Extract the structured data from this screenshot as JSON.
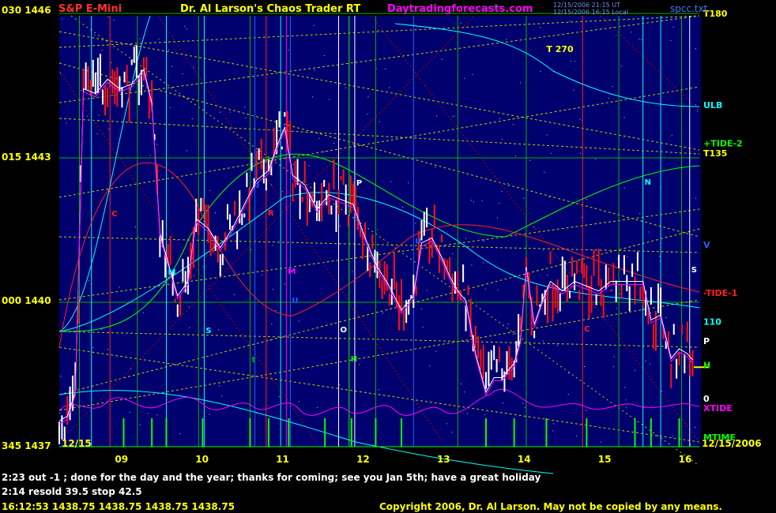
{
  "header": {
    "instrument": "S&P E-Mini",
    "product": "Dr. Al Larson's Chaos Trader RT",
    "site": "Daytradingforecasts.com",
    "timestamp_line1": "12/15/2006 21:15 UT",
    "timestamp_line2": "12/15/2006 16:15 Local",
    "file": "spcc.txt"
  },
  "colors": {
    "background": "#000000",
    "plot_area": "#00006e",
    "up_bar": "#ffffff",
    "down_bar": "#ff1010",
    "axis_text": "#ffff00",
    "grid_green": "#00c000",
    "title_red": "#ff3030",
    "site_magenta": "#ff00ff"
  },
  "chart_data": {
    "type": "candlestick",
    "title": "S&P E-Mini",
    "y_axis": {
      "ylim": [
        1437,
        1446
      ],
      "ticks": [
        {
          "value": 1446,
          "angle": "030",
          "label": "030 1446"
        },
        {
          "value": 1443,
          "angle": "015",
          "label": "015 1443"
        },
        {
          "value": 1440,
          "angle": "000",
          "label": "000 1440"
        },
        {
          "value": 1437,
          "angle": "345",
          "label": "345 1437"
        }
      ]
    },
    "x_axis": {
      "start_label": "12/15",
      "end_label": "12/15/2006",
      "hour_ticks": [
        "09",
        "10",
        "11",
        "12",
        "13",
        "14",
        "15",
        "16"
      ],
      "xlim_hours": [
        8.25,
        16.2
      ]
    },
    "price_path": [
      [
        8.25,
        1437.6
      ],
      [
        8.35,
        1437.7
      ],
      [
        8.45,
        1438.2
      ],
      [
        8.55,
        1444.5
      ],
      [
        8.7,
        1444.4
      ],
      [
        8.85,
        1444.7
      ],
      [
        9.0,
        1444.5
      ],
      [
        9.15,
        1444.6
      ],
      [
        9.3,
        1444.9
      ],
      [
        9.4,
        1444.2
      ],
      [
        9.5,
        1441.5
      ],
      [
        9.6,
        1440.9
      ],
      [
        9.72,
        1440.2
      ],
      [
        9.85,
        1440.5
      ],
      [
        9.95,
        1441.8
      ],
      [
        10.1,
        1441.6
      ],
      [
        10.25,
        1441.2
      ],
      [
        10.4,
        1441.6
      ],
      [
        10.55,
        1442.1
      ],
      [
        10.7,
        1442.6
      ],
      [
        10.85,
        1442.8
      ],
      [
        10.95,
        1443.3
      ],
      [
        11.05,
        1443.7
      ],
      [
        11.15,
        1442.7
      ],
      [
        11.3,
        1442.5
      ],
      [
        11.45,
        1442.0
      ],
      [
        11.6,
        1442.3
      ],
      [
        11.75,
        1442.2
      ],
      [
        11.9,
        1442.1
      ],
      [
        12.05,
        1441.4
      ],
      [
        12.2,
        1440.8
      ],
      [
        12.35,
        1440.4
      ],
      [
        12.5,
        1439.9
      ],
      [
        12.65,
        1440.2
      ],
      [
        12.75,
        1441.3
      ],
      [
        12.88,
        1441.4
      ],
      [
        13.0,
        1441.0
      ],
      [
        13.1,
        1440.6
      ],
      [
        13.2,
        1440.3
      ],
      [
        13.3,
        1440.1
      ],
      [
        13.42,
        1439.0
      ],
      [
        13.55,
        1438.2
      ],
      [
        13.65,
        1438.5
      ],
      [
        13.75,
        1438.5
      ],
      [
        13.9,
        1438.8
      ],
      [
        13.98,
        1439.3
      ],
      [
        14.05,
        1440.8
      ],
      [
        14.15,
        1439.6
      ],
      [
        14.25,
        1440.1
      ],
      [
        14.35,
        1440.5
      ],
      [
        14.5,
        1440.3
      ],
      [
        14.65,
        1440.5
      ],
      [
        14.8,
        1440.4
      ],
      [
        14.95,
        1440.3
      ],
      [
        15.1,
        1440.5
      ],
      [
        15.2,
        1440.5
      ],
      [
        15.3,
        1440.5
      ],
      [
        15.4,
        1440.5
      ],
      [
        15.5,
        1440.5
      ],
      [
        15.6,
        1439.7
      ],
      [
        15.72,
        1439.8
      ],
      [
        15.85,
        1438.9
      ],
      [
        15.95,
        1439.1
      ],
      [
        16.05,
        1439.0
      ],
      [
        16.15,
        1438.8
      ]
    ],
    "last_price": 1438.75,
    "vertical_lines": [
      {
        "x": 8.5,
        "label": "",
        "color": "#00b400"
      },
      {
        "x": 8.65,
        "label": "",
        "color": "#00ffff"
      },
      {
        "x": 8.88,
        "label": "C",
        "color": "#ff2020"
      },
      {
        "x": 9.22,
        "label": "",
        "color": "#00b400"
      },
      {
        "x": 9.58,
        "label": "M",
        "color": "#00ffff"
      },
      {
        "x": 9.98,
        "label": "",
        "color": "#00b400"
      },
      {
        "x": 10.05,
        "label": "S",
        "color": "#00ffff"
      },
      {
        "x": 10.62,
        "label": "t",
        "color": "#00b400"
      },
      {
        "x": 10.68,
        "label": "J",
        "color": "#2060ff"
      },
      {
        "x": 10.82,
        "label": "R",
        "color": "#ff2020"
      },
      {
        "x": 11.0,
        "label": "",
        "color": "#00ffff"
      },
      {
        "x": 11.07,
        "label": "M",
        "color": "#ff00ff"
      },
      {
        "x": 11.12,
        "label": "U",
        "color": "#2060ff"
      },
      {
        "x": 11.72,
        "label": "O",
        "color": "#ffffff"
      },
      {
        "x": 11.85,
        "label": "H",
        "color": "#00ff00"
      },
      {
        "x": 11.92,
        "label": "P",
        "color": "#ffffff"
      },
      {
        "x": 12.18,
        "label": "",
        "color": "#00b400"
      },
      {
        "x": 12.65,
        "label": "U",
        "color": "#2060ff"
      },
      {
        "x": 13.2,
        "label": "",
        "color": "#00b400"
      },
      {
        "x": 14.05,
        "label": "",
        "color": "#00b400"
      },
      {
        "x": 14.75,
        "label": "C",
        "color": "#ff2020"
      },
      {
        "x": 15.2,
        "label": "",
        "color": "#00b400"
      },
      {
        "x": 15.5,
        "label": "N",
        "color": "#00ffff"
      },
      {
        "x": 15.72,
        "label": "",
        "color": "#00ffff"
      },
      {
        "x": 15.98,
        "label": "",
        "color": "#00b400"
      },
      {
        "x": 16.08,
        "label": "S",
        "color": "#ffffff"
      }
    ],
    "right_labels": [
      {
        "text": "T180",
        "price": 1446.0,
        "color": "#ffff00"
      },
      {
        "text": "ULB",
        "price": 1444.1,
        "color": "#00ffff"
      },
      {
        "text": "+TIDE-2",
        "price": 1443.3,
        "color": "#00ff00"
      },
      {
        "text": "T135",
        "price": 1443.1,
        "color": "#ffff00"
      },
      {
        "text": "V",
        "price": 1441.2,
        "color": "#2060ff"
      },
      {
        "text": "-TIDE-1",
        "price": 1440.2,
        "color": "#ff2020"
      },
      {
        "text": "110",
        "price": 1439.6,
        "color": "#00ffff"
      },
      {
        "text": "P",
        "price": 1439.2,
        "color": "#ffffff"
      },
      {
        "text": "H",
        "price": 1438.7,
        "color": "#00ff00"
      },
      {
        "text": "0",
        "price": 1438.0,
        "color": "#ffffff"
      },
      {
        "text": "XTIDE",
        "price": 1437.8,
        "color": "#ff00ff"
      },
      {
        "text": "MTIME",
        "price": 1437.2,
        "color": "#00ff00"
      }
    ],
    "inline_labels": [
      {
        "text": "T 270",
        "x": 14.3,
        "price": 1445.2,
        "color": "#ffff00"
      }
    ],
    "status_line": "16:12:53  1438.75 1438.75 1438.75 1438.75"
  },
  "messages": [
    "2:23 out -1 ; done for the day and the year; thanks for coming; see you Jan 5th; have a great holiday",
    "2:14 resold 39.5 stop 42.5"
  ],
  "copyright": "Copyright 2006, Dr. Al Larson. May not be copied by any means."
}
